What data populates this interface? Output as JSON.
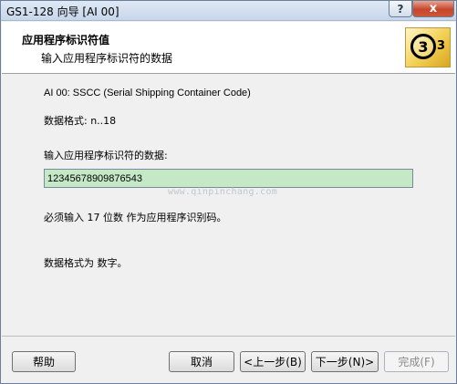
{
  "window": {
    "title": "GS1-128 向导    [AI 00]",
    "help_glyph": "?",
    "close_glyph": "x"
  },
  "header": {
    "title": "应用程序标识符值",
    "subtitle": "输入应用程序标识符的数据",
    "step_current": "3",
    "step_total": "3"
  },
  "content": {
    "ai_description": "AI 00: SSCC (Serial Shipping Container Code)",
    "data_format": "数据格式: n..18",
    "input_label": "输入应用程序标识符的数据:",
    "input_value": "12345678909876543",
    "watermark": "www.qinpinchang.com",
    "requirement": "必须输入  17 位数 作为应用程序识别码。",
    "format_type": "数据格式为 数字。"
  },
  "buttons": {
    "help": "帮助",
    "cancel": "取消",
    "back": "<上一步(B)",
    "next": "下一步(N)>",
    "finish": "完成(F)"
  }
}
